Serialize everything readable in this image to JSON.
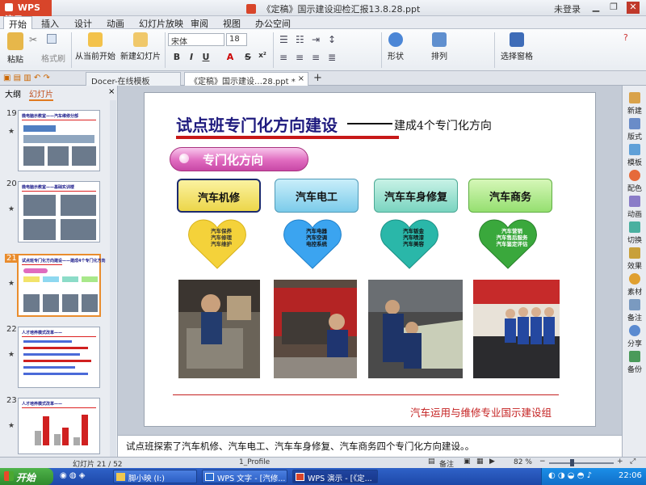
{
  "titlebar": {
    "app_label": "WPS 演示",
    "document_title": "《定稿》国示建设迎检汇报13.8.28.ppt *",
    "login_label": "未登录"
  },
  "menu": {
    "tabs": [
      "开始",
      "插入",
      "设计",
      "动画",
      "幻灯片放映",
      "审阅",
      "视图",
      "办公空间"
    ],
    "active": "开始"
  },
  "ribbon": {
    "paste": "粘贴",
    "format_painter": "格式刷",
    "from_current": "从当前开始",
    "new_slide": "新建幻灯片",
    "font_name": "宋体",
    "font_size": "18",
    "shape": "形状",
    "arrange": "排列",
    "select_pane": "选择窗格",
    "bold": "B",
    "italic": "I",
    "underline": "U",
    "font_color": "A",
    "strike": "S",
    "superscript": "x²"
  },
  "doc_tabs": {
    "tab1": "Docer-在线模板",
    "tab2": "《定稿》国示建设…28.ppt *",
    "add": "+"
  },
  "left_panel": {
    "tab_outline": "大纲",
    "tab_slides": "幻灯片",
    "thumbs": [
      {
        "num": "19",
        "title": "微电脑示教室——汽车维修分部"
      },
      {
        "num": "20",
        "title": "微电脑示教室——基础实训楼"
      },
      {
        "num": "21",
        "title": "试点班专门化方向建设——建成4个专门化方向"
      },
      {
        "num": "22",
        "title": "人才培养模式改革——"
      },
      {
        "num": "23",
        "title": "人才培养模式改革——"
      }
    ],
    "star": "★"
  },
  "slide": {
    "title": "试点班专门化方向建设",
    "subtitle": "建成4个专门化方向",
    "section_label": "专门化方向",
    "directions": [
      {
        "label": "汽车机修",
        "items": [
          "汽车保养",
          "汽车修理",
          "汽车维护"
        ]
      },
      {
        "label": "汽车电工",
        "items": [
          "汽车电器",
          "汽车空调",
          "电控系统"
        ]
      },
      {
        "label": "汽车车身修复",
        "items": [
          "汽车钣金",
          "汽车喷漆",
          "汽车美容"
        ]
      },
      {
        "label": "汽车商务",
        "items": [
          "汽车营销",
          "汽车售后服务",
          "汽车鉴定评估"
        ]
      }
    ],
    "org": "汽车运用与维修专业国示建设组"
  },
  "right_panel": {
    "items": [
      "新建",
      "版式",
      "模板",
      "配色",
      "动画",
      "切换",
      "效果",
      "素材",
      "备注",
      "分享",
      "备份"
    ]
  },
  "notes": {
    "text": "试点班探索了汽车机修、汽车电工、汽车车身修复、汽车商务四个专门化方向建设。。"
  },
  "status": {
    "slide_pos": "幻灯片 21 / 52",
    "profile": "1_Profile",
    "notes_label": "备注",
    "zoom": "82 %"
  },
  "taskbar": {
    "start": "开始",
    "tasks": [
      "脚小映 (I:)",
      "WPS 文字 - [汽修...",
      "WPS 演示 - [《定..."
    ],
    "clock": "22:06"
  },
  "colors": {
    "wps_red": "#d8452a",
    "title_blue": "#1f1b7e",
    "accent_red": "#c71818",
    "dir_box_colors": [
      "#f2e36a",
      "#8ed8f0",
      "#8cdcc8",
      "#a8e88a"
    ],
    "heart_colors": [
      "#f4d23a",
      "#3ba4f0",
      "#2ab7a9",
      "#3aa83c"
    ]
  }
}
